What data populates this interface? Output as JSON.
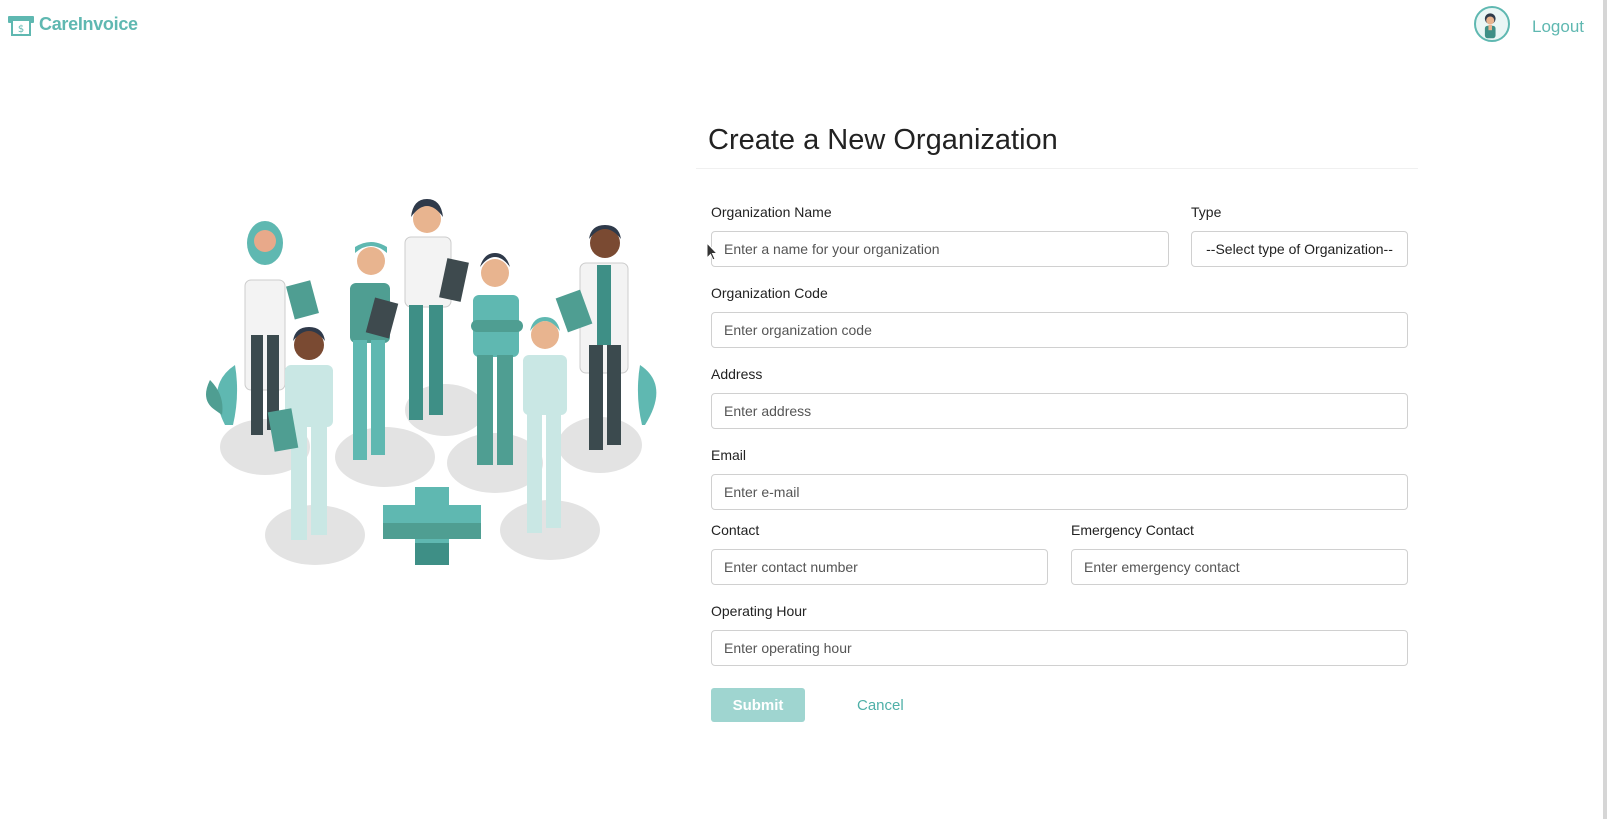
{
  "header": {
    "brand_name": "CareInvoice",
    "logout_label": "Logout"
  },
  "form": {
    "title": "Create a New Organization",
    "fields": {
      "org_name": {
        "label": "Organization Name",
        "placeholder": "Enter a name for your organization"
      },
      "type": {
        "label": "Type",
        "selected": "--Select type of Organization--"
      },
      "org_code": {
        "label": "Organization Code",
        "placeholder": "Enter organization code"
      },
      "address": {
        "label": "Address",
        "placeholder": "Enter address"
      },
      "email": {
        "label": "Email",
        "placeholder": "Enter e-mail"
      },
      "contact": {
        "label": "Contact",
        "placeholder": "Enter contact number"
      },
      "emergency_contact": {
        "label": "Emergency Contact",
        "placeholder": "Enter emergency contact"
      },
      "operating_hour": {
        "label": "Operating Hour",
        "placeholder": "Enter operating hour"
      }
    },
    "submit_label": "Submit",
    "cancel_label": "Cancel"
  },
  "colors": {
    "accent": "#5fb8b1",
    "submit_disabled": "#9fd5d0",
    "illustration_primary": "#4f9e92"
  }
}
